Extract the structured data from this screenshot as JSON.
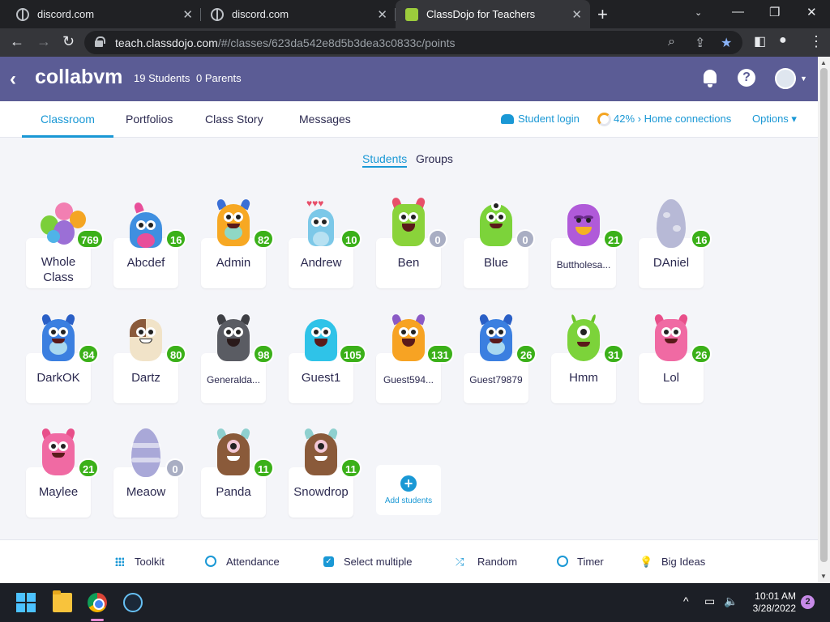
{
  "browser": {
    "tabs": [
      {
        "title": "discord.com",
        "active": false
      },
      {
        "title": "discord.com",
        "active": false
      },
      {
        "title": "ClassDojo for Teachers",
        "active": true
      }
    ],
    "address": {
      "host": "teach.classdojo.com",
      "path": "/#/classes/623da542e8d5b3dea3c0833c/points"
    }
  },
  "header": {
    "class_name": "collabvm",
    "students_count": "19 Students",
    "parents_count": "0 Parents"
  },
  "nav": {
    "tabs": [
      "Classroom",
      "Portfolios",
      "Class Story",
      "Messages"
    ],
    "active_tab": "Classroom",
    "student_login": "Student login",
    "home_connections": "42% › Home connections",
    "home_connections_progress": 0.42,
    "options": "Options"
  },
  "view_toggle": {
    "students": "Students",
    "groups": "Groups",
    "active": "Students"
  },
  "cards": [
    {
      "name": "Whole Class",
      "points": "769",
      "avatar": "group"
    },
    {
      "name": "Abcdef",
      "points": "16",
      "avatar": "party-monster"
    },
    {
      "name": "Admin",
      "points": "82",
      "avatar": "orange-monster"
    },
    {
      "name": "Andrew",
      "points": "10",
      "avatar": "blue-monster-hearts"
    },
    {
      "name": "Ben",
      "points": "0",
      "avatar": "green-monster"
    },
    {
      "name": "Blue",
      "points": "0",
      "avatar": "green-three-eyed-monster"
    },
    {
      "name": "Buttholesa...",
      "points": "21",
      "avatar": "purple-monster"
    },
    {
      "name": "DAniel",
      "points": "16",
      "avatar": "lavender-egg"
    },
    {
      "name": "DarkOK",
      "points": "84",
      "avatar": "blue-monster"
    },
    {
      "name": "Dartz",
      "points": "80",
      "avatar": "hamster-monster"
    },
    {
      "name": "Generalda...",
      "points": "98",
      "avatar": "grey-monster"
    },
    {
      "name": "Guest1",
      "points": "105",
      "avatar": "cyan-monster"
    },
    {
      "name": "Guest594...",
      "points": "131",
      "avatar": "orange-monster"
    },
    {
      "name": "Guest79879",
      "points": "26",
      "avatar": "blue-monster"
    },
    {
      "name": "Hmm",
      "points": "31",
      "avatar": "green-cyclops"
    },
    {
      "name": "Lol",
      "points": "26",
      "avatar": "pink-monster"
    },
    {
      "name": "Maylee",
      "points": "21",
      "avatar": "pink-monster"
    },
    {
      "name": "Meaow",
      "points": "0",
      "avatar": "striped-egg"
    },
    {
      "name": "Panda",
      "points": "11",
      "avatar": "brown-cyclops"
    },
    {
      "name": "Snowdrop",
      "points": "11",
      "avatar": "brown-cyclops"
    }
  ],
  "add_students": "Add students",
  "bottom_toolbar": [
    "Toolkit",
    "Attendance",
    "Select multiple",
    "Random",
    "Timer",
    "Big Ideas"
  ],
  "taskbar": {
    "time": "10:01 AM",
    "date": "3/28/2022",
    "notifications": "2"
  },
  "colors": {
    "header_bg": "#5b5c95",
    "accent": "#1a98d5",
    "points_positive": "#3bb019",
    "points_zero": "#a9aec3",
    "text_dark": "#2c2a50"
  }
}
